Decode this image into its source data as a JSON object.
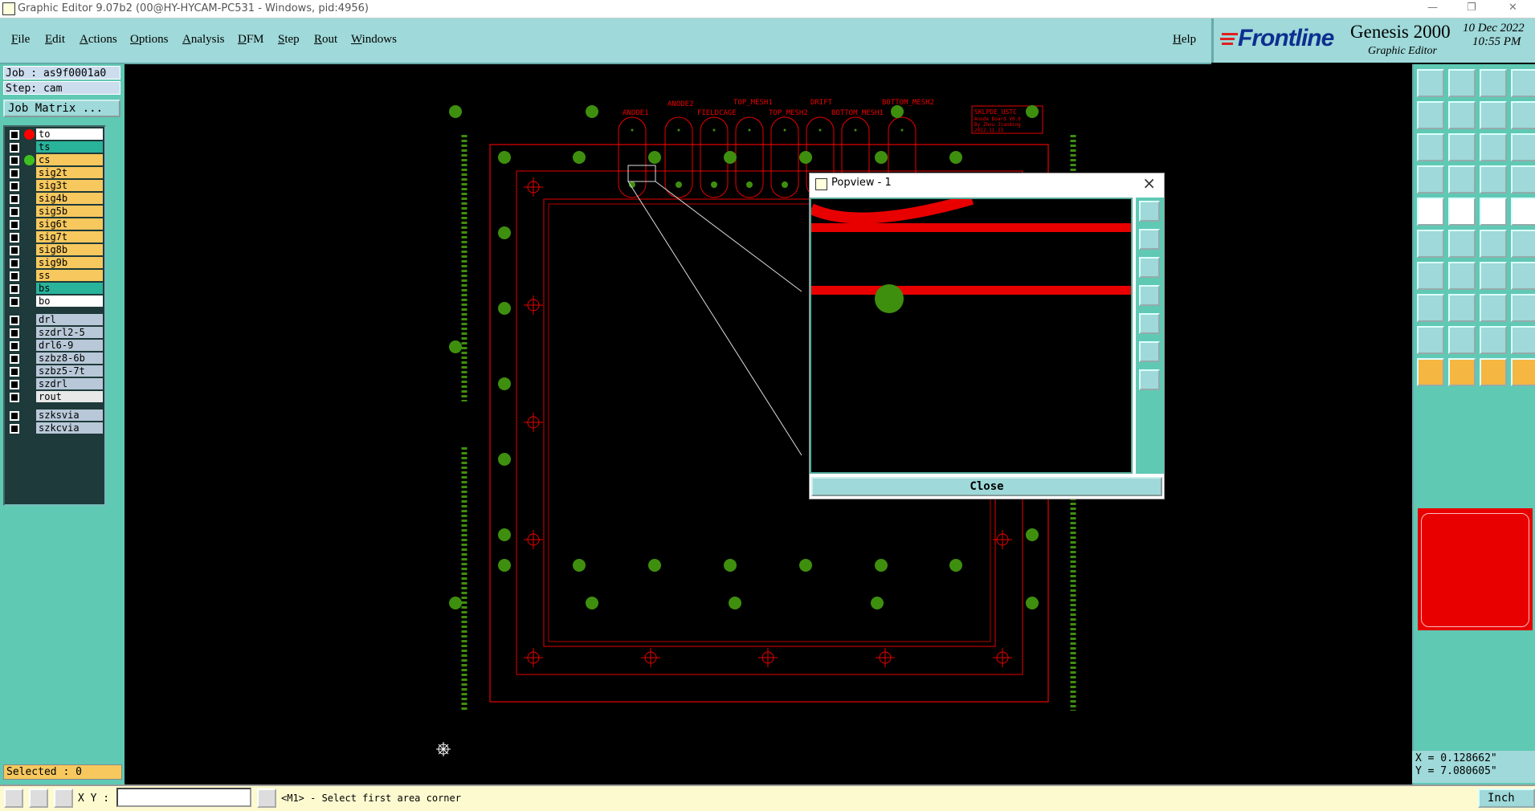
{
  "window": {
    "title": "Graphic Editor 9.07b2 (00@HY-HYCAM-PC531 - Windows, pid:4956)"
  },
  "menu": [
    "File",
    "Edit",
    "Actions",
    "Options",
    "Analysis",
    "DFM",
    "Step",
    "Rout",
    "Windows"
  ],
  "help": "Help",
  "brand": {
    "company": "Frontline",
    "product": "Genesis 2000",
    "module": "Graphic Editor",
    "date": "10 Dec 2022",
    "time": "10:55 PM"
  },
  "job": {
    "job_label": "Job : as9f0001a0",
    "step_label": "Step: cam",
    "matrix_button": "Job Matrix ..."
  },
  "layers": [
    {
      "name": "to",
      "color": "#ffffff",
      "indicator": "#ff0000"
    },
    {
      "name": "ts",
      "color": "#29b39b",
      "indicator": ""
    },
    {
      "name": "cs",
      "color": "#f6c85e",
      "indicator": "#3fbf1f"
    },
    {
      "name": "sig2t",
      "color": "#f6c85e",
      "indicator": ""
    },
    {
      "name": "sig3t",
      "color": "#f6c85e",
      "indicator": ""
    },
    {
      "name": "sig4b",
      "color": "#f6c85e",
      "indicator": ""
    },
    {
      "name": "sig5b",
      "color": "#f6c85e",
      "indicator": ""
    },
    {
      "name": "sig6t",
      "color": "#f6c85e",
      "indicator": ""
    },
    {
      "name": "sig7t",
      "color": "#f6c85e",
      "indicator": ""
    },
    {
      "name": "sig8b",
      "color": "#f6c85e",
      "indicator": ""
    },
    {
      "name": "sig9b",
      "color": "#f6c85e",
      "indicator": ""
    },
    {
      "name": "ss",
      "color": "#f6c85e",
      "indicator": ""
    },
    {
      "name": "bs",
      "color": "#29b39b",
      "indicator": ""
    },
    {
      "name": "bo",
      "color": "#ffffff",
      "indicator": ""
    },
    {
      "name": "drl",
      "color": "#b8c8d8",
      "indicator": ""
    },
    {
      "name": "szdrl2-5",
      "color": "#b8c8d8",
      "indicator": ""
    },
    {
      "name": "drl6-9",
      "color": "#b8c8d8",
      "indicator": ""
    },
    {
      "name": "szbz8-6b",
      "color": "#b8c8d8",
      "indicator": ""
    },
    {
      "name": "szbz5-7t",
      "color": "#b8c8d8",
      "indicator": ""
    },
    {
      "name": "szdrl",
      "color": "#b8c8d8",
      "indicator": ""
    },
    {
      "name": "rout",
      "color": "#e8e8e8",
      "indicator": ""
    },
    {
      "name": "szksvia",
      "color": "#b8c8d8",
      "indicator": ""
    },
    {
      "name": "szkcvia",
      "color": "#b8c8d8",
      "indicator": ""
    }
  ],
  "selected": "Selected : 0",
  "board_labels": [
    "ANODE1",
    "ANODE2",
    "FIELDCAGE",
    "TOP_MESH1",
    "TOP_MESH2",
    "DRIFT",
    "BOTTOM_MESH1",
    "BOTTOM_MESH2"
  ],
  "board_stamp": [
    "SKLPDE_USTC",
    "Anode Board V0.0",
    "By Zhou Jianbing",
    "2022.11.23"
  ],
  "popview": {
    "title": "Popview - 1",
    "close": "Close"
  },
  "coords": {
    "x": "X = 0.128662\"",
    "y": "Y = 7.080605\""
  },
  "status": {
    "xy_label": "X Y :",
    "xy_value": "",
    "message": "<M1> - Select first area corner",
    "units": "Inch"
  },
  "colors": {
    "panel": "#5fc9b4",
    "menubar": "#9fd9d9",
    "feature_red": "#e80000",
    "pad_green": "#3f8f0f"
  }
}
